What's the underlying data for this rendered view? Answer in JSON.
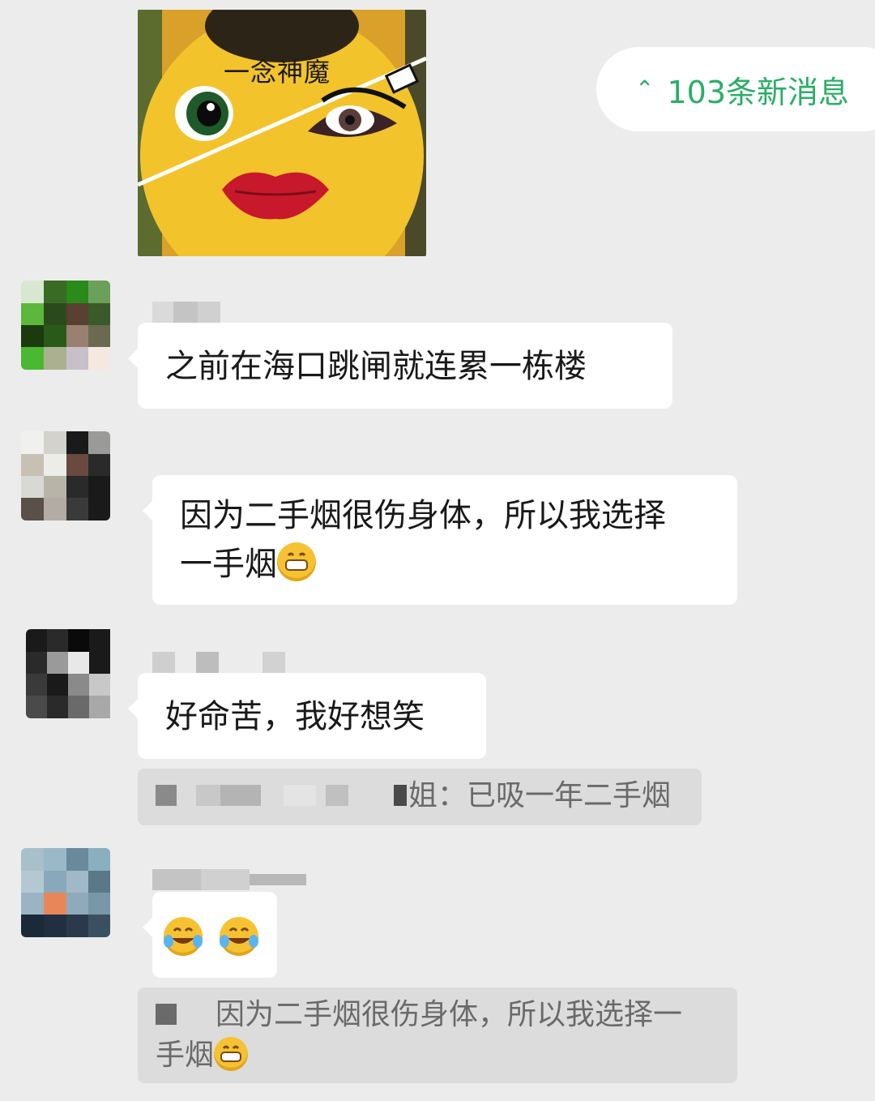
{
  "sticker": {
    "caption": "一念神魔"
  },
  "new_messages": {
    "icon": "chevron-double-up-icon",
    "label": "103条新消息",
    "color": "#2aae67"
  },
  "messages": [
    {
      "text": "之前在海口跳闸就连累一栋楼"
    },
    {
      "line1": "因为二手烟很伤身体，所以我选择",
      "line2": "一手烟",
      "emoji": "grinning-face-icon"
    },
    {
      "text": "好命苦，我好想笑"
    },
    {
      "emoji": [
        "tears-of-joy-icon",
        "tears-of-joy-icon"
      ]
    }
  ],
  "quotes": [
    {
      "text": "姐：已吸一年二手烟"
    },
    {
      "line1": "因为二手烟很伤身体，所以我选择一",
      "line2": "手烟",
      "emoji": "grinning-face-icon"
    }
  ],
  "colors": {
    "background": "#ececec",
    "bubble": "#ffffff",
    "quote": "#dcdcdc",
    "accent": "#2aae67"
  }
}
